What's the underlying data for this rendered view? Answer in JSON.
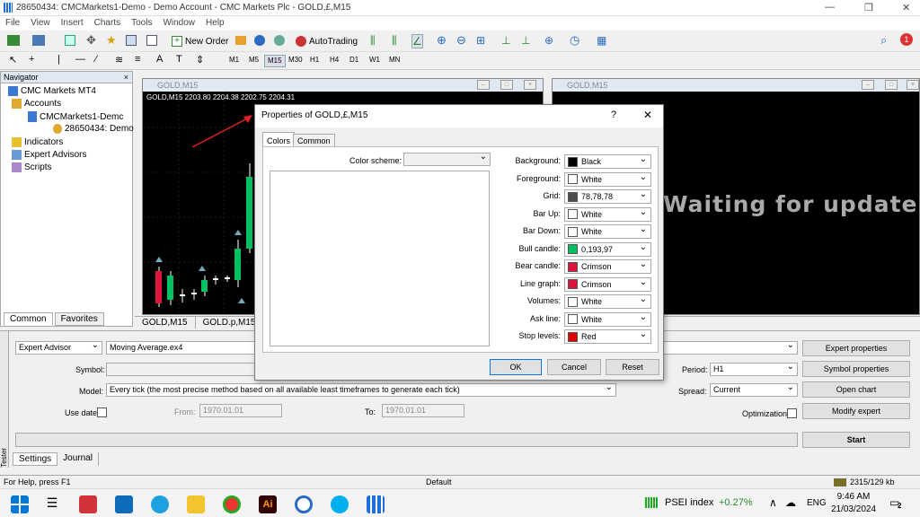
{
  "window": {
    "title": "28650434: CMCMarkets1-Demo - Demo Account - CMC Markets Plc - GOLD,£,M15"
  },
  "menu": [
    "File",
    "View",
    "Insert",
    "Charts",
    "Tools",
    "Window",
    "Help"
  ],
  "toolbar": {
    "new_order": "New Order",
    "autotrading": "AutoTrading"
  },
  "timeframes": [
    "M1",
    "M5",
    "M15",
    "M30",
    "H1",
    "H4",
    "D1",
    "W1",
    "MN"
  ],
  "active_timeframe": "M15",
  "navigator": {
    "title": "Navigator",
    "root": "CMC Markets MT4",
    "accounts": "Accounts",
    "server": "CMCMarkets1-Demc",
    "account": "28650434: Demo",
    "indicators": "Indicators",
    "experts": "Expert Advisors",
    "scripts": "Scripts",
    "tab_common": "Common",
    "tab_favorites": "Favorites"
  },
  "chart1": {
    "title": "GOLD,M15",
    "header": "GOLD,M15  2203.80 2204.38 2202.75 2204.31"
  },
  "chart2": {
    "title": "GOLD,M15",
    "message": "Waiting for update"
  },
  "chart_tabs": [
    "GOLD,M15",
    "GOLD.p,M15"
  ],
  "tester": {
    "type": "Expert Advisor",
    "ea": "Moving Average.ex4",
    "symbol_label": "Symbol:",
    "model_label": "Model:",
    "model": "Every tick (the most precise method based on all available least timeframes to generate each tick)",
    "use_date": "Use date",
    "from_label": "From:",
    "from": "1970.01.01",
    "to_label": "To:",
    "to": "1970.01.01",
    "period_label": "Period:",
    "period": "H1",
    "spread_label": "Spread:",
    "spread": "Current",
    "optimization": "Optimization",
    "btn_expert_props": "Expert properties",
    "btn_symbol_props": "Symbol properties",
    "btn_open_chart": "Open chart",
    "btn_modify": "Modify expert",
    "btn_start": "Start",
    "tab_settings": "Settings",
    "tab_journal": "Journal",
    "side_label": "Tester"
  },
  "dialog": {
    "title": "Properties of GOLD,£,M15",
    "help": "?",
    "tab_colors": "Colors",
    "tab_common": "Common",
    "scheme_label": "Color scheme:",
    "ok": "OK",
    "cancel": "Cancel",
    "reset": "Reset",
    "props": [
      {
        "label": "Background:",
        "value": "Black",
        "color": "#000000"
      },
      {
        "label": "Foreground:",
        "value": "White",
        "color": "#ffffff"
      },
      {
        "label": "Grid:",
        "value": "78,78,78",
        "color": "#4e4e4e"
      },
      {
        "label": "Bar Up:",
        "value": "White",
        "color": "#ffffff"
      },
      {
        "label": "Bar Down:",
        "value": "White",
        "color": "#ffffff"
      },
      {
        "label": "Bull candle:",
        "value": "0,193,97",
        "color": "#00c161"
      },
      {
        "label": "Bear candle:",
        "value": "Crimson",
        "color": "#dc143c"
      },
      {
        "label": "Line graph:",
        "value": "Crimson",
        "color": "#dc143c"
      },
      {
        "label": "Volumes:",
        "value": "White",
        "color": "#ffffff"
      },
      {
        "label": "Ask line:",
        "value": "White",
        "color": "#ffffff"
      },
      {
        "label": "Stop levels:",
        "value": "Red",
        "color": "#e00000"
      }
    ]
  },
  "status": {
    "help": "For Help, press F1",
    "profile": "Default",
    "traffic": "2315/129 kb"
  },
  "taskbar": {
    "ticker": "PSEI index",
    "change": "+0.27%",
    "lang": "ENG",
    "time": "9:46 AM",
    "date": "21/03/2024",
    "badge": "2",
    "notif_count": "1"
  }
}
